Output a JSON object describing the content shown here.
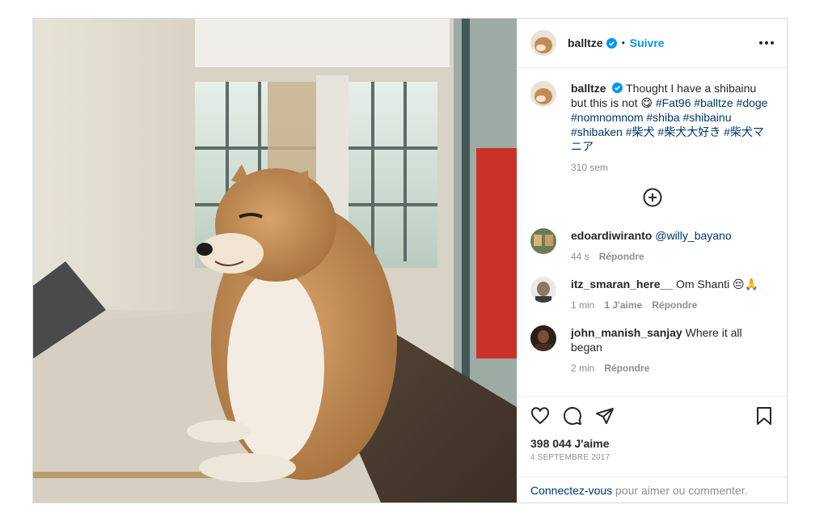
{
  "post": {
    "author": "balltze",
    "follow_label": "Suivre",
    "caption": {
      "text_before": "Thought I have a shibainu but this is not",
      "emoji": "😋",
      "tags": [
        "#Fat96",
        "#balltze",
        "#doge",
        "#nomnomnom",
        "#shiba",
        "#shibainu",
        "#shibaken",
        "#柴犬",
        "#柴犬大好き",
        "#柴犬マニア"
      ],
      "age": "310 sem"
    },
    "comments": [
      {
        "user": "edoardiwiranto",
        "mention": "@willy_bayano",
        "text": "",
        "age": "44 s",
        "likes": "",
        "reply": "Répondre"
      },
      {
        "user": "itz_smaran_here__",
        "mention": "",
        "text": "Om Shanti 😔🙏",
        "age": "1 min",
        "likes": "1 J'aime",
        "reply": "Répondre"
      },
      {
        "user": "john_manish_sanjay",
        "mention": "",
        "text": "Where it all began",
        "age": "2 min",
        "likes": "",
        "reply": "Répondre"
      }
    ],
    "likes": "398 044 J'aime",
    "date": "4 SEPTEMBRE 2017",
    "login": {
      "link": "Connectez-vous",
      "rest": " pour aimer ou commenter."
    }
  },
  "colors": {
    "accent": "#0095f6",
    "link": "#00376b",
    "muted": "#8e8e8e"
  },
  "icons": [
    "more-options-icon",
    "verified-badge-icon",
    "load-more-comments-icon",
    "heart-icon",
    "comment-icon",
    "share-icon",
    "save-icon"
  ]
}
